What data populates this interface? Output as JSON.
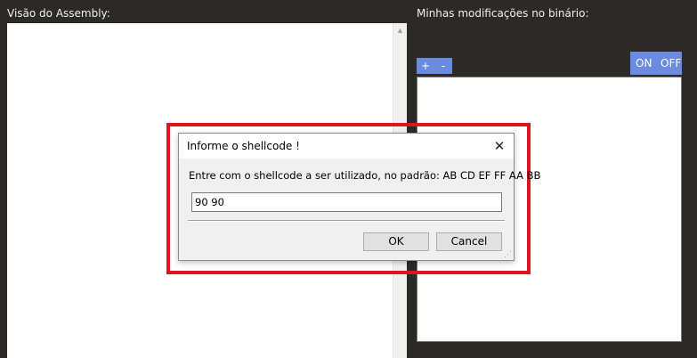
{
  "panels": {
    "assembly_label": "Visão do Assembly:",
    "modifications_label": "Minhas modificações no binário:"
  },
  "toolbar": {
    "add_label": "+",
    "remove_label": "-",
    "on_label": "ON",
    "off_label": "OFF"
  },
  "dialog": {
    "title": "Informe o shellcode !",
    "close_symbol": "✕",
    "prompt": "Entre com o shellcode a ser utilizado, no padrão: AB CD EF FF AA BB",
    "input_value": "90 90",
    "ok_label": "OK",
    "cancel_label": "Cancel"
  },
  "colors": {
    "background": "#2b2a27",
    "accent": "#6a8be0",
    "highlight": "#e0141e"
  }
}
